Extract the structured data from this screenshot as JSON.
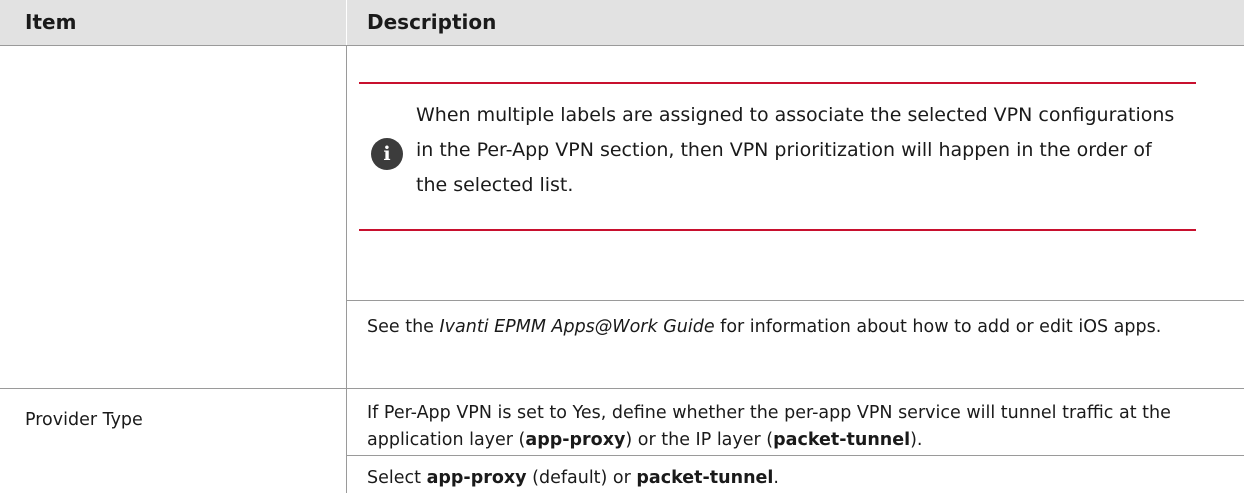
{
  "table": {
    "header": {
      "item": "Item",
      "description": "Description"
    },
    "row1": {
      "note": {
        "icon": "info-icon",
        "glyph": "i",
        "text": "When multiple labels are assigned to associate the selected VPN configurations in the Per-App VPN section, then VPN prioritization will happen in the order of the selected list."
      },
      "see": {
        "prefix": "See the ",
        "guide": "Ivanti EPMM Apps@Work Guide",
        "suffix": " for information about how to add or edit iOS apps."
      }
    },
    "row2": {
      "item": "Provider Type",
      "desc": {
        "part1": "If Per-App VPN is set to Yes, define whether the per-app VPN service will tunnel traffic at the application layer (",
        "app_proxy": "app-proxy",
        "part2": ") or the IP layer (",
        "packet_tunnel": "packet-tunnel",
        "part3": ")."
      },
      "select": {
        "prefix": "Select ",
        "app_proxy": "app-proxy",
        "middle": " (default) or ",
        "packet_tunnel": "packet-tunnel",
        "suffix": "."
      }
    }
  },
  "colors": {
    "header_bg": "#e2e2e2",
    "rule_red": "#c8102e",
    "border_gray": "#9a9a9a",
    "icon_dark": "#3c3c3c"
  }
}
